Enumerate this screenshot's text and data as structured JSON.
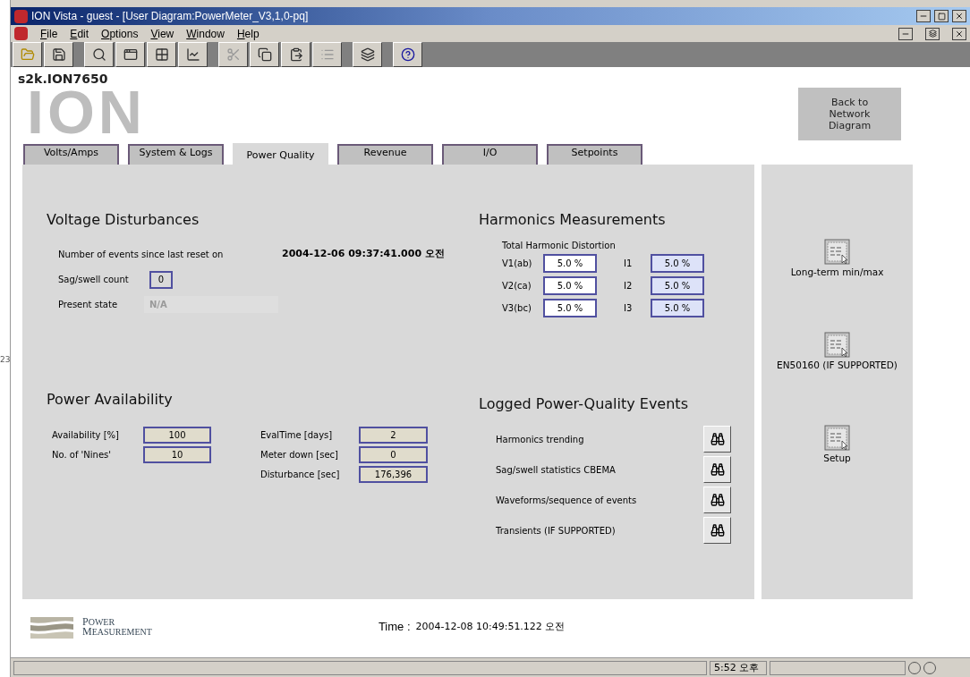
{
  "background_text": "23",
  "window": {
    "title": "ION Vista - guest - [User Diagram:PowerMeter_V3,1,0-pq]"
  },
  "menu": [
    "File",
    "Edit",
    "Options",
    "View",
    "Window",
    "Help"
  ],
  "device": "s2k.ION7650",
  "logo": "ION",
  "back_button": "Back to Network Diagram",
  "tabs": [
    {
      "label": "Volts/Amps",
      "selected": false
    },
    {
      "label": "System & Logs",
      "selected": false
    },
    {
      "label": "Power Quality",
      "selected": true
    },
    {
      "label": "Revenue",
      "selected": false
    },
    {
      "label": "I/O",
      "selected": false
    },
    {
      "label": "Setpoints",
      "selected": false
    }
  ],
  "voltage_disturbances": {
    "title": "Voltage Disturbances",
    "reset_label": "Number of events since last reset on",
    "reset_time": "2004-12-06 09:37:41.000 오전",
    "sag_label": "Sag/swell count",
    "sag_value": "0",
    "state_label": "Present state",
    "state_value": "N/A"
  },
  "harmonics": {
    "title": "Harmonics Measurements",
    "subtitle": "Total Harmonic Distortion",
    "rows": [
      {
        "v_label": "V1(ab)",
        "v_value": "5.0 %",
        "i_label": "I1",
        "i_value": "5.0 %"
      },
      {
        "v_label": "V2(ca)",
        "v_value": "5.0 %",
        "i_label": "I2",
        "i_value": "5.0 %"
      },
      {
        "v_label": "V3(bc)",
        "v_value": "5.0 %",
        "i_label": "I3",
        "i_value": "5.0 %"
      }
    ]
  },
  "availability": {
    "title": "Power Availability",
    "left": [
      {
        "label": "Availability [%]",
        "value": "100"
      },
      {
        "label": "No. of 'Nines'",
        "value": "10"
      }
    ],
    "right": [
      {
        "label": "EvalTime [days]",
        "value": "2"
      },
      {
        "label": "Meter down [sec]",
        "value": "0"
      },
      {
        "label": "Disturbance [sec]",
        "value": "176,396"
      }
    ]
  },
  "events": {
    "title": "Logged Power-Quality Events",
    "items": [
      "Harmonics trending",
      "Sag/swell statistics CBEMA",
      "Waveforms/sequence of events",
      "Transients (IF SUPPORTED)"
    ]
  },
  "side_links": [
    "Long-term min/max",
    "EN50160 (IF SUPPORTED)",
    "Setup"
  ],
  "footer": {
    "brand": [
      "POWER",
      "MEASUREMENT"
    ],
    "time_label": "Time :",
    "time": "2004-12-08 10:49:51.122 오전"
  },
  "status_bar": {
    "clock": "5:52 오후"
  }
}
